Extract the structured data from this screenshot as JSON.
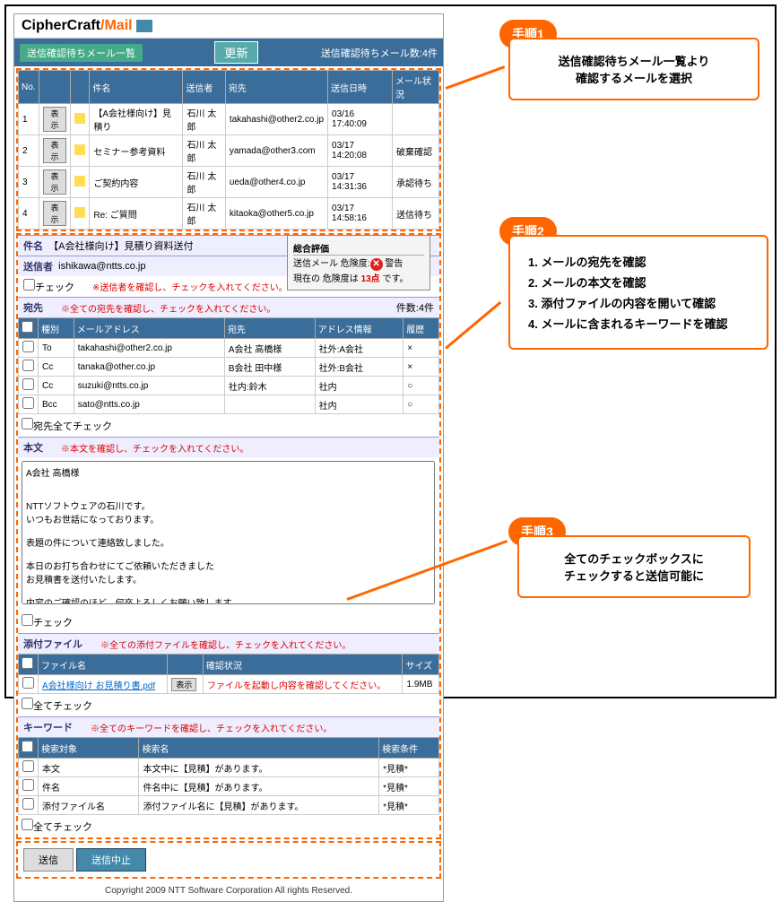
{
  "brand": {
    "p1": "CipherCraft",
    "p2": "/Mail"
  },
  "bar": {
    "title": "送信確認待ちメール一覧",
    "update": "更新",
    "count": "送信確認待ちメール数:4件"
  },
  "list": {
    "h": [
      "No.",
      "",
      "",
      "件名",
      "送信者",
      "宛先",
      "送信日時",
      "メール状況"
    ],
    "rows": [
      {
        "n": "1",
        "b": "表示",
        "s": "【A会社様向け】見積り",
        "f": "石川 太郎",
        "t": "takahashi@other2.co.jp",
        "d": "03/16 17:40:09",
        "st": ""
      },
      {
        "n": "2",
        "b": "表示",
        "s": "セミナー参考資料",
        "f": "石川 太郎",
        "t": "yamada@other3.com",
        "d": "03/17 14:20:08",
        "st": "破棄確認"
      },
      {
        "n": "3",
        "b": "表示",
        "s": "ご契約内容",
        "f": "石川 太郎",
        "t": "ueda@other4.co.jp",
        "d": "03/17 14:31:36",
        "st": "承認待ち"
      },
      {
        "n": "4",
        "b": "表示",
        "s": "Re: ご質問",
        "f": "石川 太郎",
        "t": "kitaoka@other5.co.jp",
        "d": "03/17 14:58:16",
        "st": "送信待ち"
      }
    ]
  },
  "subj": {
    "l": "件名",
    "v": "【A会社様向け】見積り資料送付"
  },
  "from": {
    "l": "送信者",
    "v": "ishikawa@ntts.co.jp",
    "chk": "チェック",
    "note": "※送信者を確認し、チェックを入れてください。"
  },
  "eval": {
    "t": "総合評価",
    "l1": "送信メール 危険度:",
    "w": "警告",
    "l2a": "現在の 危険度は",
    "pt": "13点",
    "l2b": "です。"
  },
  "dest": {
    "t": "宛先",
    "note": "※全ての宛先を確認し、チェックを入れてください。",
    "cnt": "件数:4件",
    "h": [
      "",
      "種別",
      "メールアドレス",
      "宛先",
      "アドレス情報",
      "履歴"
    ],
    "rows": [
      {
        "k": "To",
        "m": "takahashi@other2.co.jp",
        "n": "A会社 高橋様",
        "i": "社外:A会社",
        "r": "×"
      },
      {
        "k": "Cc",
        "m": "tanaka@other.co.jp",
        "n": "B会社 田中様",
        "i": "社外:B会社",
        "r": "×"
      },
      {
        "k": "Cc",
        "m": "suzuki@ntts.co.jp",
        "n": "社内:鈴木",
        "i": "社内",
        "r": "○"
      },
      {
        "k": "Bcc",
        "m": "sato@ntts.co.jp",
        "n": "",
        "i": "社内",
        "r": "○"
      }
    ],
    "all": "宛先全てチェック"
  },
  "body": {
    "t": "本文",
    "note": "※本文を確認し、チェックを入れてください。",
    "v": "A会社 高橋様\n\n\nNTTソフトウェアの石川です。\nいつもお世話になっております。\n\n表題の件について連絡致しました。\n\n本日のお打ち合わせにてご依頼いただきました\nお見積書を送付いたします。\n\n内容のご確認のほど、何卒よろしくお願い致します。",
    "chk": "チェック"
  },
  "att": {
    "t": "添付ファイル",
    "note": "※全ての添付ファイルを確認し、チェックを入れてください。",
    "h": [
      "",
      "ファイル名",
      "",
      "確認状況",
      "サイズ"
    ],
    "rows": [
      {
        "f": "A会社様向け お見積り書.pdf",
        "b": "表示",
        "s": "ファイルを起動し内容を確認してください。",
        "z": "1.9MB"
      }
    ],
    "all": "全てチェック"
  },
  "kw": {
    "t": "キーワード",
    "note": "※全てのキーワードを確認し、チェックを入れてください。",
    "h": [
      "",
      "検索対象",
      "検索名",
      "検索条件"
    ],
    "rows": [
      {
        "o": "本文",
        "n": "本文中に【見積】があります。",
        "c": "*見積*"
      },
      {
        "o": "件名",
        "n": "件名中に【見積】があります。",
        "c": "*見積*"
      },
      {
        "o": "添付ファイル名",
        "n": "添付ファイル名に【見積】があります。",
        "c": "*見積*"
      }
    ],
    "all": "全てチェック"
  },
  "btns": {
    "send": "送信",
    "cancel": "送信中止"
  },
  "cr": "Copyright 2009 NTT Software Corporation All rights Reserved.",
  "c1": {
    "b": "手順1",
    "l1": "送信確認待ちメール一覧より",
    "l2": "確認するメールを選択"
  },
  "c2": {
    "b": "手順2",
    "l1": "1. メールの宛先を確認",
    "l2": "2. メールの本文を確認",
    "l3": "3. 添付ファイルの内容を開いて確認",
    "l4": "4. メールに含まれるキーワードを確認"
  },
  "c3": {
    "b": "手順3",
    "l1": "全てのチェックボックスに",
    "l2": "チェックすると送信可能に"
  }
}
